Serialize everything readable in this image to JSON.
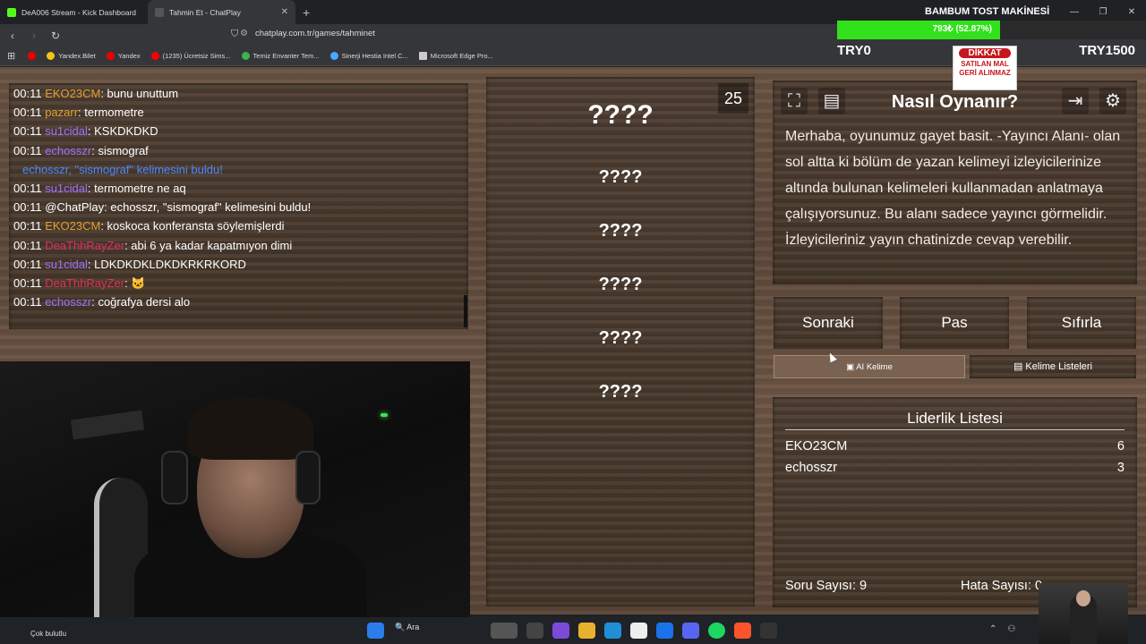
{
  "tabs": [
    {
      "label": "DeA006 Stream - Kick Dashboard",
      "favicon_color": "#53fc18"
    },
    {
      "label": "Tahmin Et - ChatPlay",
      "favicon_color": "#ffffff"
    }
  ],
  "address": {
    "url": "chatplay.com.tr/games/tahminet"
  },
  "bookmarks": [
    {
      "label": "",
      "color": "#e00"
    },
    {
      "label": "Yandex.Bilet",
      "color": "#f5c518"
    },
    {
      "label": "Yandex",
      "color": "#e00"
    },
    {
      "label": "(1235) Ücretsiz Sims...",
      "color": "#f00"
    },
    {
      "label": "Temiz Envanter Tem...",
      "color": "#3ab54a"
    },
    {
      "label": "Sinerji Hestia Intel C...",
      "color": "#4aa8ff"
    },
    {
      "label": "Microsoft Edge Pro...",
      "color": "#ccc"
    }
  ],
  "overlay": {
    "title": "BAMBUM TOST MAKİNESİ",
    "progress_text": "793₺ (52.87%)",
    "progress_fraction": 0.5287,
    "left_label": "TRY0",
    "right_label": "TRY1500",
    "badge_top": "DİKKAT",
    "badge_line1": "SATILAN MAL",
    "badge_line2": "GERİ ALINMAZ"
  },
  "chat": [
    {
      "time": "00:11",
      "user": "EKO23CM",
      "user_color": "#e0a030",
      "text": "bunu unuttum"
    },
    {
      "time": "00:11",
      "user": "pazarr",
      "user_color": "#e0a030",
      "text": "termometre"
    },
    {
      "time": "00:11",
      "user": "su1cidal",
      "user_color": "#a070ff",
      "text": "KSKDKDKD"
    },
    {
      "time": "00:11",
      "user": "echosszr",
      "user_color": "#a070ff",
      "text": "sismograf"
    },
    {
      "time": "",
      "user": "echosszr,",
      "user_color": "#4a88ff",
      "text": "\"sismograf\" kelimesini buldu!",
      "system": true
    },
    {
      "time": "00:11",
      "user": "su1cidal",
      "user_color": "#a070ff",
      "text": "termometre ne aq"
    },
    {
      "time": "00:11",
      "user": "@ChatPlay",
      "user_color": "#ffffff",
      "text": "echosszr, \"sismograf\" kelimesini buldu!"
    },
    {
      "time": "00:11",
      "user": "EKO23CM",
      "user_color": "#e0a030",
      "text": "koskoca konferansta söylemişlerdi"
    },
    {
      "time": "00:11",
      "user": "DeaThhRayZer",
      "user_color": "#e0305a",
      "text": "abi 6 ya kadar kapatmıyon dimi"
    },
    {
      "time": "00:11",
      "user": "su1cidal",
      "user_color": "#a070ff",
      "text": "LDKDKDKLDKDKRKRKORD"
    },
    {
      "time": "00:11",
      "user": "DeaThhRayZer",
      "user_color": "#e0305a",
      "text": "🐱"
    },
    {
      "time": "00:11",
      "user": "echosszr",
      "user_color": "#a070ff",
      "text": "coğrafya dersi alo"
    }
  ],
  "game": {
    "timer": "25",
    "main_word": "????",
    "forbidden_words": [
      "????",
      "????",
      "????",
      "????",
      "????"
    ]
  },
  "howto": {
    "title": "Nasıl Oynanır?",
    "text": "Merhaba, oyunumuz gayet basit. -Yayıncı Alanı- olan sol altta ki bölüm de yazan kelimeyi izleyicilerinize altında bulunan kelimeleri kullanmadan anlatmaya çalışıyorsunuz. Bu alanı sadece yayıncı görmelidir. İzleyicileriniz yayın chatinizde cevap verebilir."
  },
  "buttons": {
    "next": "Sonraki",
    "pass": "Pas",
    "reset": "Sıfırla",
    "ai_word": "AI Kelime",
    "word_lists": "Kelime Listeleri"
  },
  "leaderboard": {
    "title": "Liderlik Listesi",
    "rows": [
      {
        "name": "EKO23CM",
        "score": "6"
      },
      {
        "name": "echosszr",
        "score": "3"
      }
    ],
    "question_count": "Soru Sayısı: 9",
    "error_count": "Hata Sayısı: 0"
  },
  "taskbar": {
    "weather": "Çok bulutlu",
    "search": "Ara"
  }
}
